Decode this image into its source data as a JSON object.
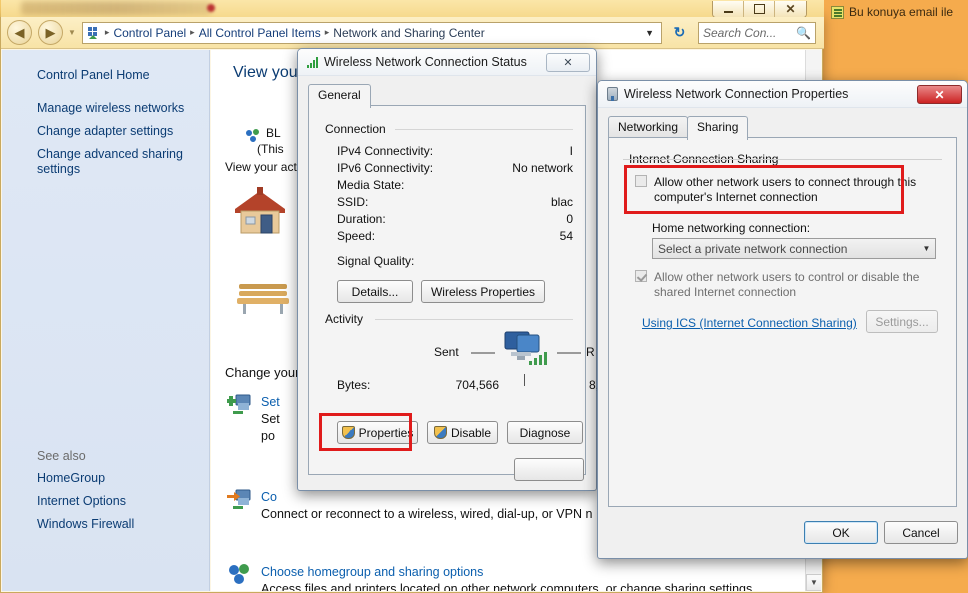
{
  "desktop": {
    "email_link_text": "Bu konuya email ile",
    "email_icon": "email-compose-icon"
  },
  "control_panel": {
    "titlebar": {
      "minimize_label": "",
      "maximize_label": "",
      "close_label": "✕"
    },
    "addressbar": {
      "back_glyph": "◀",
      "forward_glyph": "▶",
      "history_glyph": "▼",
      "breadcrumbs": [
        "Control Panel",
        "All Control Panel Items",
        "Network and Sharing Center"
      ],
      "separator": "▸",
      "caret": "▼",
      "refresh_glyph": "↻",
      "search_placeholder": "Search Con...",
      "search_icon": "magnifier-icon"
    },
    "sidebar": {
      "home_label": "Control Panel Home",
      "items": [
        "Manage wireless networks",
        "Change adapter settings",
        "Change advanced sharing settings"
      ],
      "see_also_label": "See also",
      "see_also_items": [
        "HomeGroup",
        "Internet Options",
        "Windows Firewall"
      ]
    },
    "main": {
      "page_title": "View your",
      "network_name": "BL",
      "network_sub": "(This",
      "activity_label": "View your act",
      "change_your_label": "Change your",
      "items": [
        {
          "title": "Set",
          "desc_line1": "Set",
          "desc_line2": "po",
          "icon": "new-connection-icon"
        },
        {
          "title": "Co",
          "desc_line1": "Connect or reconnect to a wireless, wired, dial-up, or VPN n",
          "desc_line2": "",
          "icon": "connect-network-icon"
        },
        {
          "title": "Choose homegroup and sharing options",
          "desc_line1": "Access files and printers located on other network computers, or change sharing settings.",
          "desc_line2": "",
          "icon": "homegroup-icon"
        }
      ],
      "help_glyph": "?",
      "collapse_glyph": "▲",
      "scroll_down_glyph": "▼"
    }
  },
  "status_dialog": {
    "title": "Wireless Network Connection Status",
    "icon": "wifi-signal-icon",
    "close_glyph": "✕",
    "tabs": [
      {
        "label": "General",
        "active": true
      }
    ],
    "connection_group": "Connection",
    "connection_rows": [
      {
        "label": "IPv4 Connectivity:",
        "value": "I"
      },
      {
        "label": "IPv6 Connectivity:",
        "value": "No network"
      },
      {
        "label": "Media State:",
        "value": ""
      },
      {
        "label": "SSID:",
        "value": "blac"
      },
      {
        "label": "Duration:",
        "value": "0"
      },
      {
        "label": "Speed:",
        "value": "54"
      }
    ],
    "signal_quality_label": "Signal Quality:",
    "buttons": {
      "details": "Details...",
      "wireless_properties": "Wireless Properties"
    },
    "activity_group": "Activity",
    "activity_sent_label": "Sent",
    "activity_received_label": "R",
    "bytes_label": "Bytes:",
    "bytes_sent": "704,566",
    "bytes_received": "8,",
    "action_buttons": {
      "properties": "Properties",
      "disable": "Disable",
      "diagnose": "Diagnose"
    }
  },
  "properties_dialog": {
    "title": "Wireless Network Connection Properties",
    "icon": "network-adapter-icon",
    "close_glyph": "✕",
    "tabs": [
      {
        "label": "Networking",
        "active": false
      },
      {
        "label": "Sharing",
        "active": true
      }
    ],
    "group_label": "Internet Connection Sharing",
    "allow_connect_checkbox": {
      "checked": false,
      "line1": "Allow other network users to connect through this",
      "line2": "computer's Internet connection"
    },
    "home_networking_label": "Home networking connection:",
    "home_networking_value": "Select a private network connection",
    "home_networking_arrow": "▼",
    "allow_control_checkbox": {
      "checked": true,
      "disabled": true,
      "line1": "Allow other network users to control or disable the",
      "line2": "shared Internet connection"
    },
    "ics_link": "Using ICS (Internet Connection Sharing)",
    "settings_button": "Settings...",
    "ok_button": "OK",
    "cancel_button": "Cancel"
  },
  "colors": {
    "accent_blue": "#0b5fae",
    "highlight_red": "#e01b1b",
    "desktop_orange": "#f0a741",
    "sidebar_blue": "#dfe8f5"
  }
}
